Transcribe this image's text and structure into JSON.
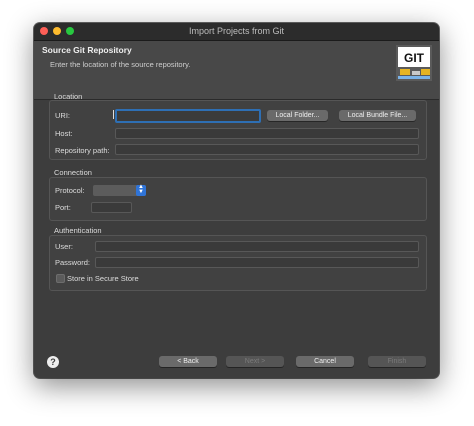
{
  "window": {
    "title": "Import Projects from Git"
  },
  "header": {
    "title": "Source Git Repository",
    "description": "Enter the location of the source repository.",
    "logo_text": "GIT"
  },
  "location": {
    "group_label": "Location",
    "uri_label": "URI:",
    "uri_value": "",
    "host_label": "Host:",
    "host_value": "",
    "repo_path_label": "Repository path:",
    "repo_path_value": "",
    "local_folder_button": "Local Folder...",
    "local_bundle_button": "Local Bundle File..."
  },
  "connection": {
    "group_label": "Connection",
    "protocol_label": "Protocol:",
    "protocol_value": "",
    "port_label": "Port:",
    "port_value": ""
  },
  "authentication": {
    "group_label": "Authentication",
    "user_label": "User:",
    "user_value": "",
    "password_label": "Password:",
    "password_value": "",
    "secure_store_label": "Store in Secure Store",
    "secure_store_checked": false
  },
  "footer": {
    "help_glyph": "?",
    "back_button": "< Back",
    "next_button": "Next >",
    "cancel_button": "Cancel",
    "finish_button": "Finish"
  },
  "colors": {
    "window_bg": "#3d3d3d",
    "focus_ring": "#2e6fb4",
    "select_accent": "#2f74d8",
    "traffic_red": "#fe5f57",
    "traffic_yellow": "#febc2e",
    "traffic_green": "#28c840"
  }
}
